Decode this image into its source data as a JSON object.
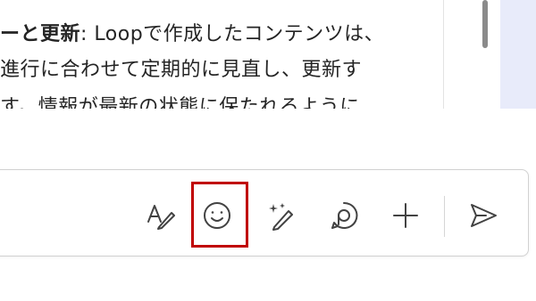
{
  "message": {
    "line1_bold": "ーと更新",
    "line1_rest": ": Loopで作成したコンテンツは、",
    "line2": "進行に合わせて定期的に見直し、更新す",
    "line3": "す。情報が最新の状態に保たれるように"
  },
  "toolbar": {
    "icons": [
      "format-icon",
      "emoji-icon",
      "copilot-icon",
      "loop-icon",
      "plus-icon",
      "send-icon"
    ],
    "highlighted": "emoji-icon",
    "highlight_color": "#c00000"
  }
}
